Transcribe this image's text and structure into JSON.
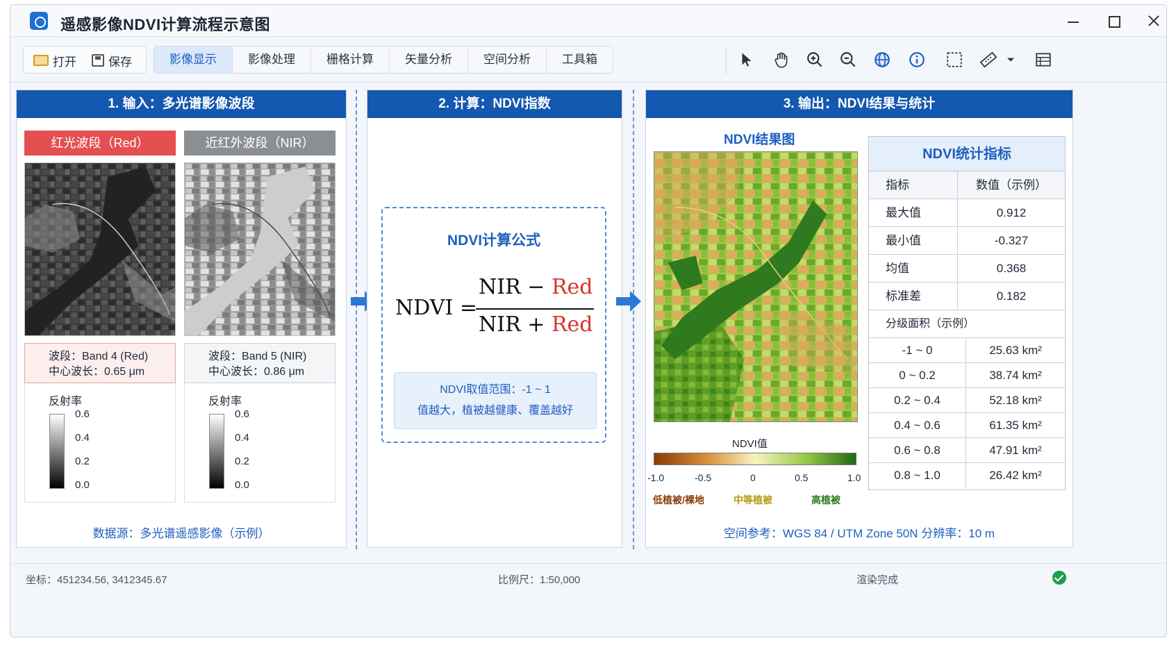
{
  "window": {
    "title": "遥感影像NDVI计算流程示意图"
  },
  "toolbar": {
    "open_label": "打开",
    "save_label": "保存",
    "tabs": [
      {
        "label": "影像显示",
        "active": true
      },
      {
        "label": "影像处理"
      },
      {
        "label": "栅格计算"
      },
      {
        "label": "矢量分析"
      },
      {
        "label": "空间分析"
      },
      {
        "label": "工具箱"
      }
    ],
    "tools": [
      "pointer-icon",
      "pan-hand-icon",
      "zoom-in-icon",
      "zoom-out-icon",
      "globe-icon",
      "info-icon",
      "select-rect-icon",
      "measure-ruler-icon",
      "dropdown-chevron-icon",
      "attribute-table-icon"
    ]
  },
  "panel1": {
    "title": "1. 输入：多光谱影像波段",
    "red": {
      "label": "红光波段（Red）",
      "band": "波段：Band 4 (Red)",
      "wavelength": "中心波长：0.65 μm",
      "refl_title": "反射率",
      "ticks": [
        "0.6",
        "0.4",
        "0.2",
        "0.0"
      ]
    },
    "nir": {
      "label": "近红外波段（NIR）",
      "band": "波段：Band 5 (NIR)",
      "wavelength": "中心波长：0.86 μm",
      "refl_title": "反射率",
      "ticks": [
        "0.6",
        "0.4",
        "0.2",
        "0.0"
      ]
    },
    "source": "数据源：多光谱遥感影像（示例）"
  },
  "panel2": {
    "title": "2. 计算：NDVI指数",
    "formula_title": "NDVI计算公式",
    "lhs": "NDVI =",
    "nir": "NIR",
    "minus": "−",
    "plus": "+",
    "red": "Red",
    "range": "NDVI取值范围：-1 ~ 1",
    "meaning": "值越大，植被越健康、覆盖越好"
  },
  "panel3": {
    "title": "3. 输出：NDVI结果与统计",
    "map_title": "NDVI结果图",
    "legend_title": "NDVI值",
    "legend_ticks": [
      "-1.0",
      "-0.5",
      "0",
      "0.5",
      "1.0"
    ],
    "legend_classes": [
      {
        "label": "低植被/裸地",
        "color": "#8a3b07"
      },
      {
        "label": "中等植被",
        "color": "#b59a10"
      },
      {
        "label": "高植被",
        "color": "#2b7a1a"
      }
    ],
    "stats": {
      "title": "NDVI统计指标",
      "col1": "指标",
      "col2": "数值（示例）",
      "rows": [
        {
          "name": "最大值",
          "value": "0.912"
        },
        {
          "name": "最小值",
          "value": "-0.327"
        },
        {
          "name": "均值",
          "value": "0.368"
        },
        {
          "name": "标准差",
          "value": "0.182"
        }
      ],
      "area_title": "分级面积（示例）",
      "areas": [
        {
          "range": "-1 ~ 0",
          "value": "25.63 km²"
        },
        {
          "range": "0 ~ 0.2",
          "value": "38.74 km²"
        },
        {
          "range": "0.2 ~ 0.4",
          "value": "52.18 km²"
        },
        {
          "range": "0.4 ~ 0.6",
          "value": "61.35 km²"
        },
        {
          "range": "0.6 ~ 0.8",
          "value": "47.91 km²"
        },
        {
          "range": "0.8 ~ 1.0",
          "value": "26.42 km²"
        }
      ]
    },
    "reference": "空间参考：WGS 84 / UTM Zone 50N    分辨率：10 m"
  },
  "statusbar": {
    "coords": "坐标：451234.56, 3412345.67",
    "scale": "比例尺：1:50,000",
    "status": "渲染完成"
  },
  "colors": {
    "accent": "#1458b0",
    "red_band": "#e45050",
    "nir_band": "#8b8f94"
  }
}
